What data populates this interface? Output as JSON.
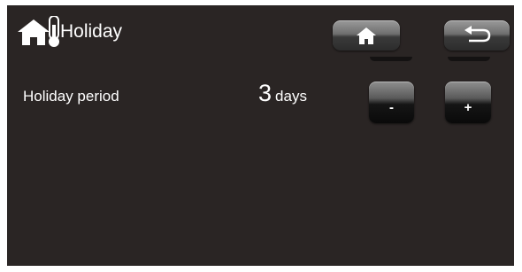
{
  "header": {
    "title": "Holiday",
    "icon": "house-thermometer-icon"
  },
  "toolbar": {
    "home_icon": "home-icon",
    "back_icon": "back-arrow-icon"
  },
  "setting": {
    "label": "Holiday period",
    "value": "3",
    "unit": "days",
    "decrement_label": "-",
    "increment_label": "+"
  },
  "colors": {
    "background": "#2a2524",
    "text": "#ffffff"
  }
}
